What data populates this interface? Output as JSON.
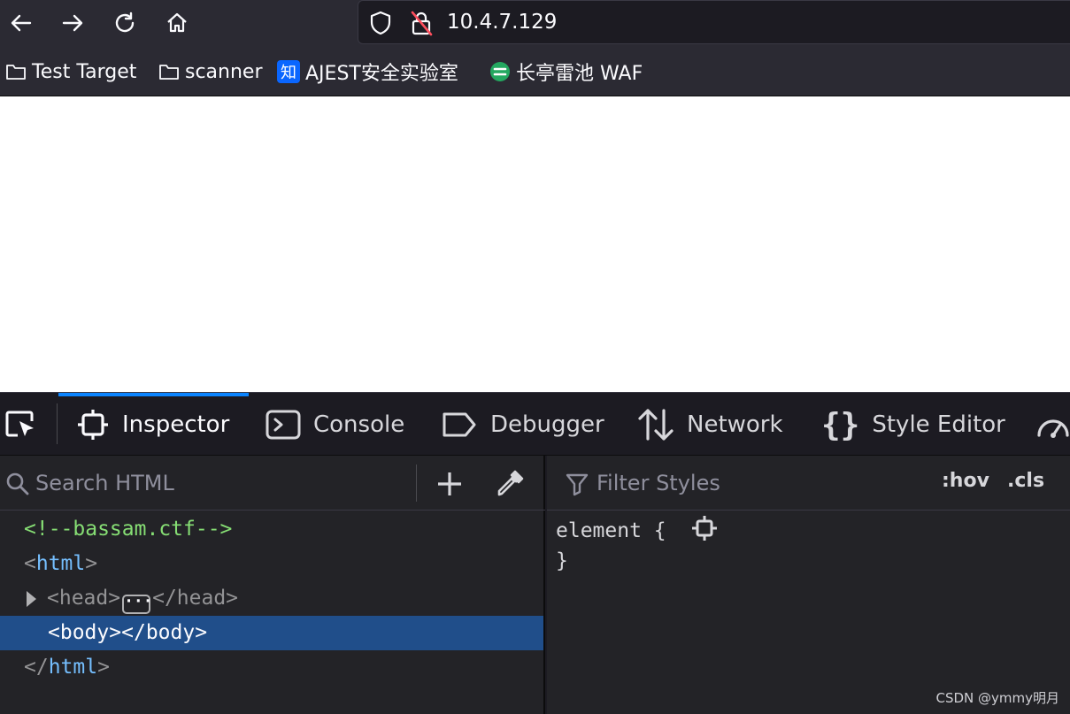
{
  "browser": {
    "url": "10.4.7.129",
    "bookmarks": [
      {
        "label": "Test Target",
        "icon": "folder-icon"
      },
      {
        "label": "scanner",
        "icon": "folder-icon"
      },
      {
        "label": "AJEST安全实验室",
        "icon": "zhi-favicon",
        "favicon_text": "知"
      },
      {
        "label": "长亭雷池 WAF",
        "icon": "safeline-favicon"
      }
    ]
  },
  "devtools": {
    "tabs": [
      {
        "label": "Inspector",
        "icon": "inspector-icon"
      },
      {
        "label": "Console",
        "icon": "console-icon"
      },
      {
        "label": "Debugger",
        "icon": "debugger-icon"
      },
      {
        "label": "Network",
        "icon": "network-icon"
      },
      {
        "label": "Style Editor",
        "icon": "braces-icon"
      }
    ],
    "inspector": {
      "search_placeholder": "Search HTML",
      "tree": {
        "comment": "<!--bassam.ctf-->",
        "html_open_lt": "<",
        "html_open_name": "html",
        "html_open_gt": ">",
        "head_open": "<head>",
        "head_close": "</head>",
        "body_open_lt": "<",
        "body_open_name": "body",
        "body_open_gt": ">",
        "body_close_lt": "</",
        "body_close_name": "body",
        "body_close_gt": ">",
        "html_close_lt": "</",
        "html_close_name": "html",
        "html_close_gt": ">"
      }
    },
    "rules": {
      "filter_placeholder": "Filter Styles",
      "hov_label": ":hov",
      "cls_label": ".cls",
      "element_selector": "element {",
      "element_close": "}"
    }
  },
  "watermark": "CSDN @ymmy明月",
  "colors": {
    "accent": "#0a84ff",
    "selected_row": "#204e8a",
    "comment": "#86de74",
    "tag_name": "#75bfff"
  }
}
